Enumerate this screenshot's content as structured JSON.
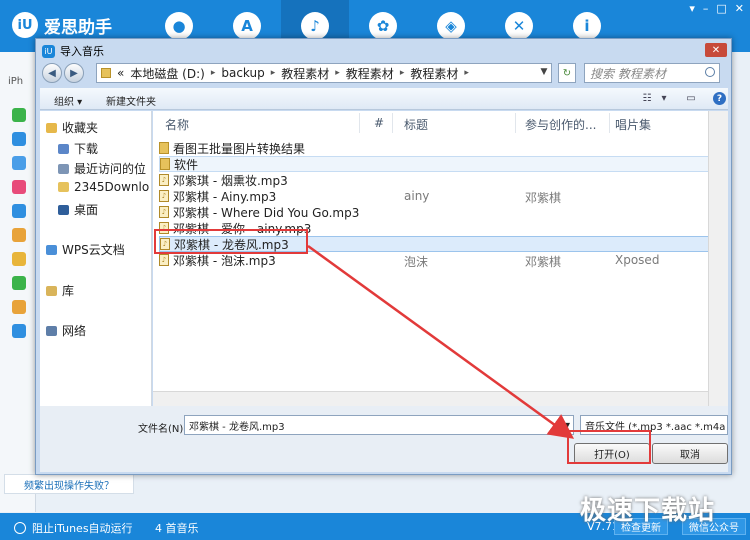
{
  "app": {
    "logo_text": "爱思助手",
    "logo_mark": "iU",
    "nav_icons": [
      "apple-icon",
      "app-store-icon",
      "bell-icon",
      "flower-icon",
      "dropbox-icon",
      "tools-icon",
      "info-icon"
    ],
    "win_controls": [
      "▾",
      "–",
      "□",
      "✕"
    ],
    "strip_label": "iPh"
  },
  "dialog": {
    "title": "导入音乐",
    "close": "✕",
    "address": {
      "prefix": "«",
      "segments": [
        "本地磁盘 (D:)",
        "backup",
        "教程素材",
        "教程素材",
        "教程素材"
      ]
    },
    "search_placeholder": "搜索 教程素材",
    "toolbar": {
      "organize": "组织 ▾",
      "new_folder": "新建文件夹"
    },
    "tree": [
      {
        "label": "收藏夹",
        "color": "#e6b84a"
      },
      {
        "label": "下载",
        "color": "#5b86c8"
      },
      {
        "label": "最近访问的位",
        "color": "#7d95b5"
      },
      {
        "label": "2345Downlo",
        "color": "#e6c25c"
      },
      {
        "label": "桌面",
        "color": "#2f5e9a"
      },
      {
        "label": "WPS云文档",
        "color": "#4a8fd8"
      },
      {
        "label": "库",
        "color": "#d9b45a"
      },
      {
        "label": "网络",
        "color": "#5e7ea8"
      }
    ],
    "columns": [
      "名称",
      "#",
      "标题",
      "参与创作的...",
      "唱片集"
    ],
    "files": [
      {
        "name": "看图王批量图片转换结果",
        "type": "folder",
        "title": "",
        "artist": "",
        "album": ""
      },
      {
        "name": "软件",
        "type": "folder",
        "title": "",
        "artist": "",
        "album": ""
      },
      {
        "name": "邓紫琪 - 烟熏妆.mp3",
        "type": "audio",
        "title": "",
        "artist": "",
        "album": ""
      },
      {
        "name": "邓紫棋 - Ainy.mp3",
        "type": "audio",
        "title": "ainy",
        "artist": "邓紫棋",
        "album": ""
      },
      {
        "name": "邓紫棋 - Where Did You Go.mp3",
        "type": "audio",
        "title": "",
        "artist": "",
        "album": ""
      },
      {
        "name": "邓紫棋 - 爱你 - ainy.mp3",
        "type": "audio",
        "title": "",
        "artist": "",
        "album": ""
      },
      {
        "name": "邓紫棋 - 龙卷风.mp3",
        "type": "audio",
        "title": "",
        "artist": "",
        "album": ""
      },
      {
        "name": "邓紫棋 - 泡沫.mp3",
        "type": "audio",
        "title": "泡沫",
        "artist": "邓紫棋",
        "album": "Xposed"
      }
    ],
    "filename_label": "文件名(N):",
    "filename_value": "邓紫棋 - 龙卷风.mp3",
    "filetype": "音乐文件 (*.mp3 *.aac *.m4a",
    "open_button": "打开(O)",
    "cancel_button": "取消"
  },
  "sidebar_link": "频繁出现操作失败？",
  "status": {
    "itunes_toggle": "阻止iTunes自动运行",
    "music_count": "4 首音乐",
    "version": "V7.71",
    "check_update": "检查更新",
    "wechat": "微信公众号"
  },
  "watermark": "极速下载站",
  "colors": {
    "accent": "#1a86d9",
    "highlight": "#e23a3a"
  }
}
